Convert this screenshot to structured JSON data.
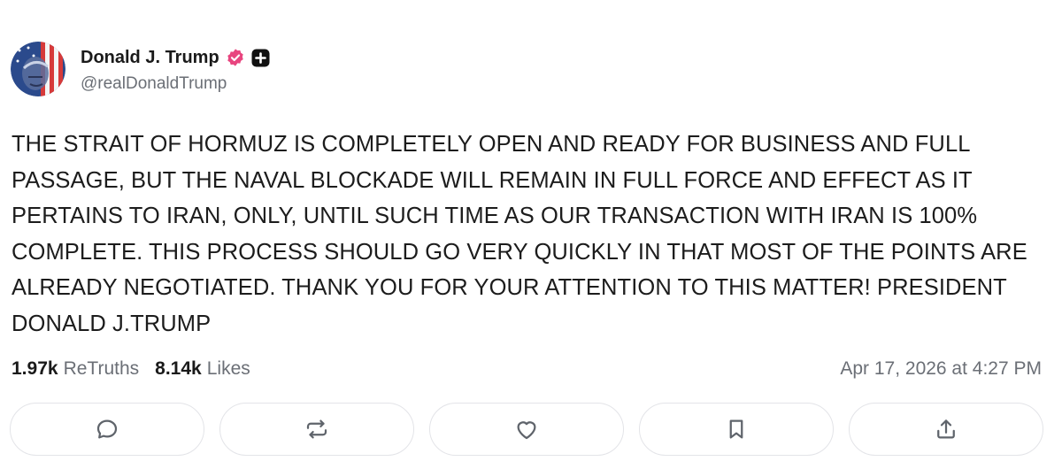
{
  "post": {
    "author": {
      "display_name": "Donald J. Trump",
      "handle": "@realDonaldTrump",
      "verified": true
    },
    "text_lines": [
      "THE STRAIT OF HORMUZ IS COMPLETELY OPEN AND READY FOR BUSINESS AND FULL",
      "PASSAGE, BUT THE NAVAL BLOCKADE WILL REMAIN IN FULL FORCE AND EFFECT AS IT",
      "PERTAINS TO IRAN, ONLY, UNTIL SUCH TIME AS OUR TRANSACTION WITH IRAN IS 100%",
      "COMPLETE. THIS PROCESS SHOULD GO VERY QUICKLY IN THAT MOST OF THE POINTS ARE",
      "ALREADY NEGOTIATED. THANK YOU FOR YOUR ATTENTION TO THIS MATTER! PRESIDENT",
      "DONALD J.TRUMP"
    ],
    "stats": {
      "retruths_count": "1.97k",
      "retruths_label": "ReTruths",
      "likes_count": "8.14k",
      "likes_label": "Likes"
    },
    "timestamp": "Apr 17, 2026 at 4:27 PM"
  },
  "actions": [
    {
      "name": "reply",
      "icon": "speech-bubble-icon"
    },
    {
      "name": "retruth",
      "icon": "repost-arrows-icon"
    },
    {
      "name": "like",
      "icon": "heart-icon"
    },
    {
      "name": "bookmark",
      "icon": "bookmark-icon"
    },
    {
      "name": "share",
      "icon": "share-upload-icon"
    }
  ],
  "colors": {
    "text": "#1c1c1c",
    "muted": "#6b6f76",
    "verified": "#e8457f",
    "button_border": "#e3e4e8",
    "icon": "#5f646b"
  }
}
